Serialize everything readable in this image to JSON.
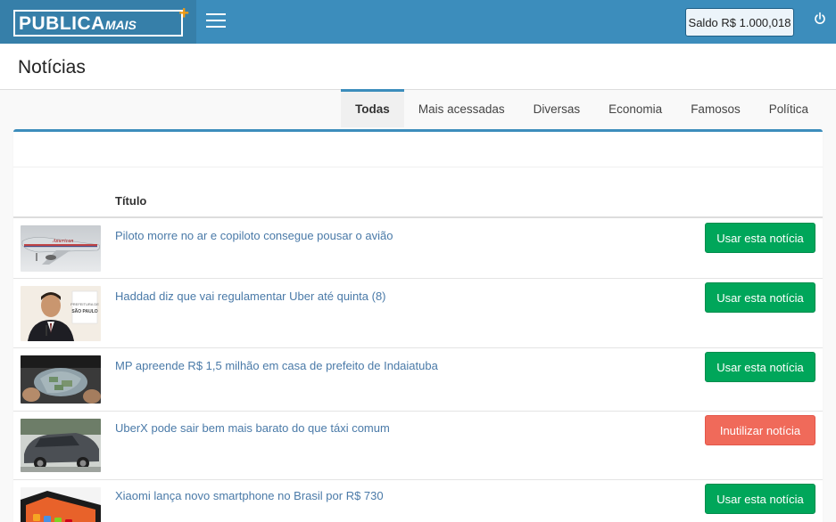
{
  "app": {
    "logo_main": "PUBLICA",
    "logo_sub": "MAIS",
    "logo_plus": "+",
    "saldo": "Saldo R$ 1.000,018"
  },
  "page": {
    "title": "Notícias"
  },
  "tabs": [
    {
      "label": "Todas",
      "active": true
    },
    {
      "label": "Mais acessadas",
      "active": false
    },
    {
      "label": "Diversas",
      "active": false
    },
    {
      "label": "Economia",
      "active": false
    },
    {
      "label": "Famosos",
      "active": false
    },
    {
      "label": "Política",
      "active": false
    }
  ],
  "table": {
    "header_title": "Título",
    "rows": [
      {
        "title": "Piloto morre no ar e copiloto consegue pousar o avião",
        "action": "Usar esta notícia",
        "action_type": "use"
      },
      {
        "title": "Haddad diz que vai regulamentar Uber até quinta (8)",
        "action": "Usar esta notícia",
        "action_type": "use"
      },
      {
        "title": "MP apreende R$ 1,5 milhão em casa de prefeito de Indaiatuba",
        "action": "Usar esta notícia",
        "action_type": "use"
      },
      {
        "title": "UberX pode sair bem mais barato do que táxi comum",
        "action": "Inutilizar notícia",
        "action_type": "discard"
      },
      {
        "title": "Xiaomi lança novo smartphone no Brasil por R$ 730",
        "action": "Usar esta notícia",
        "action_type": "use"
      }
    ]
  },
  "thumbnail_text": {
    "airline": "American",
    "placard_1": "PREFEITURA DE",
    "placard_2": "SÃO PAULO"
  },
  "colors": {
    "topbar": "#3c8dbc",
    "logo_bg": "#367fa9",
    "accent_orange": "#f39c12",
    "btn_green": "#00a65a",
    "btn_red": "#f06a5a",
    "link": "#4a7aa8"
  }
}
